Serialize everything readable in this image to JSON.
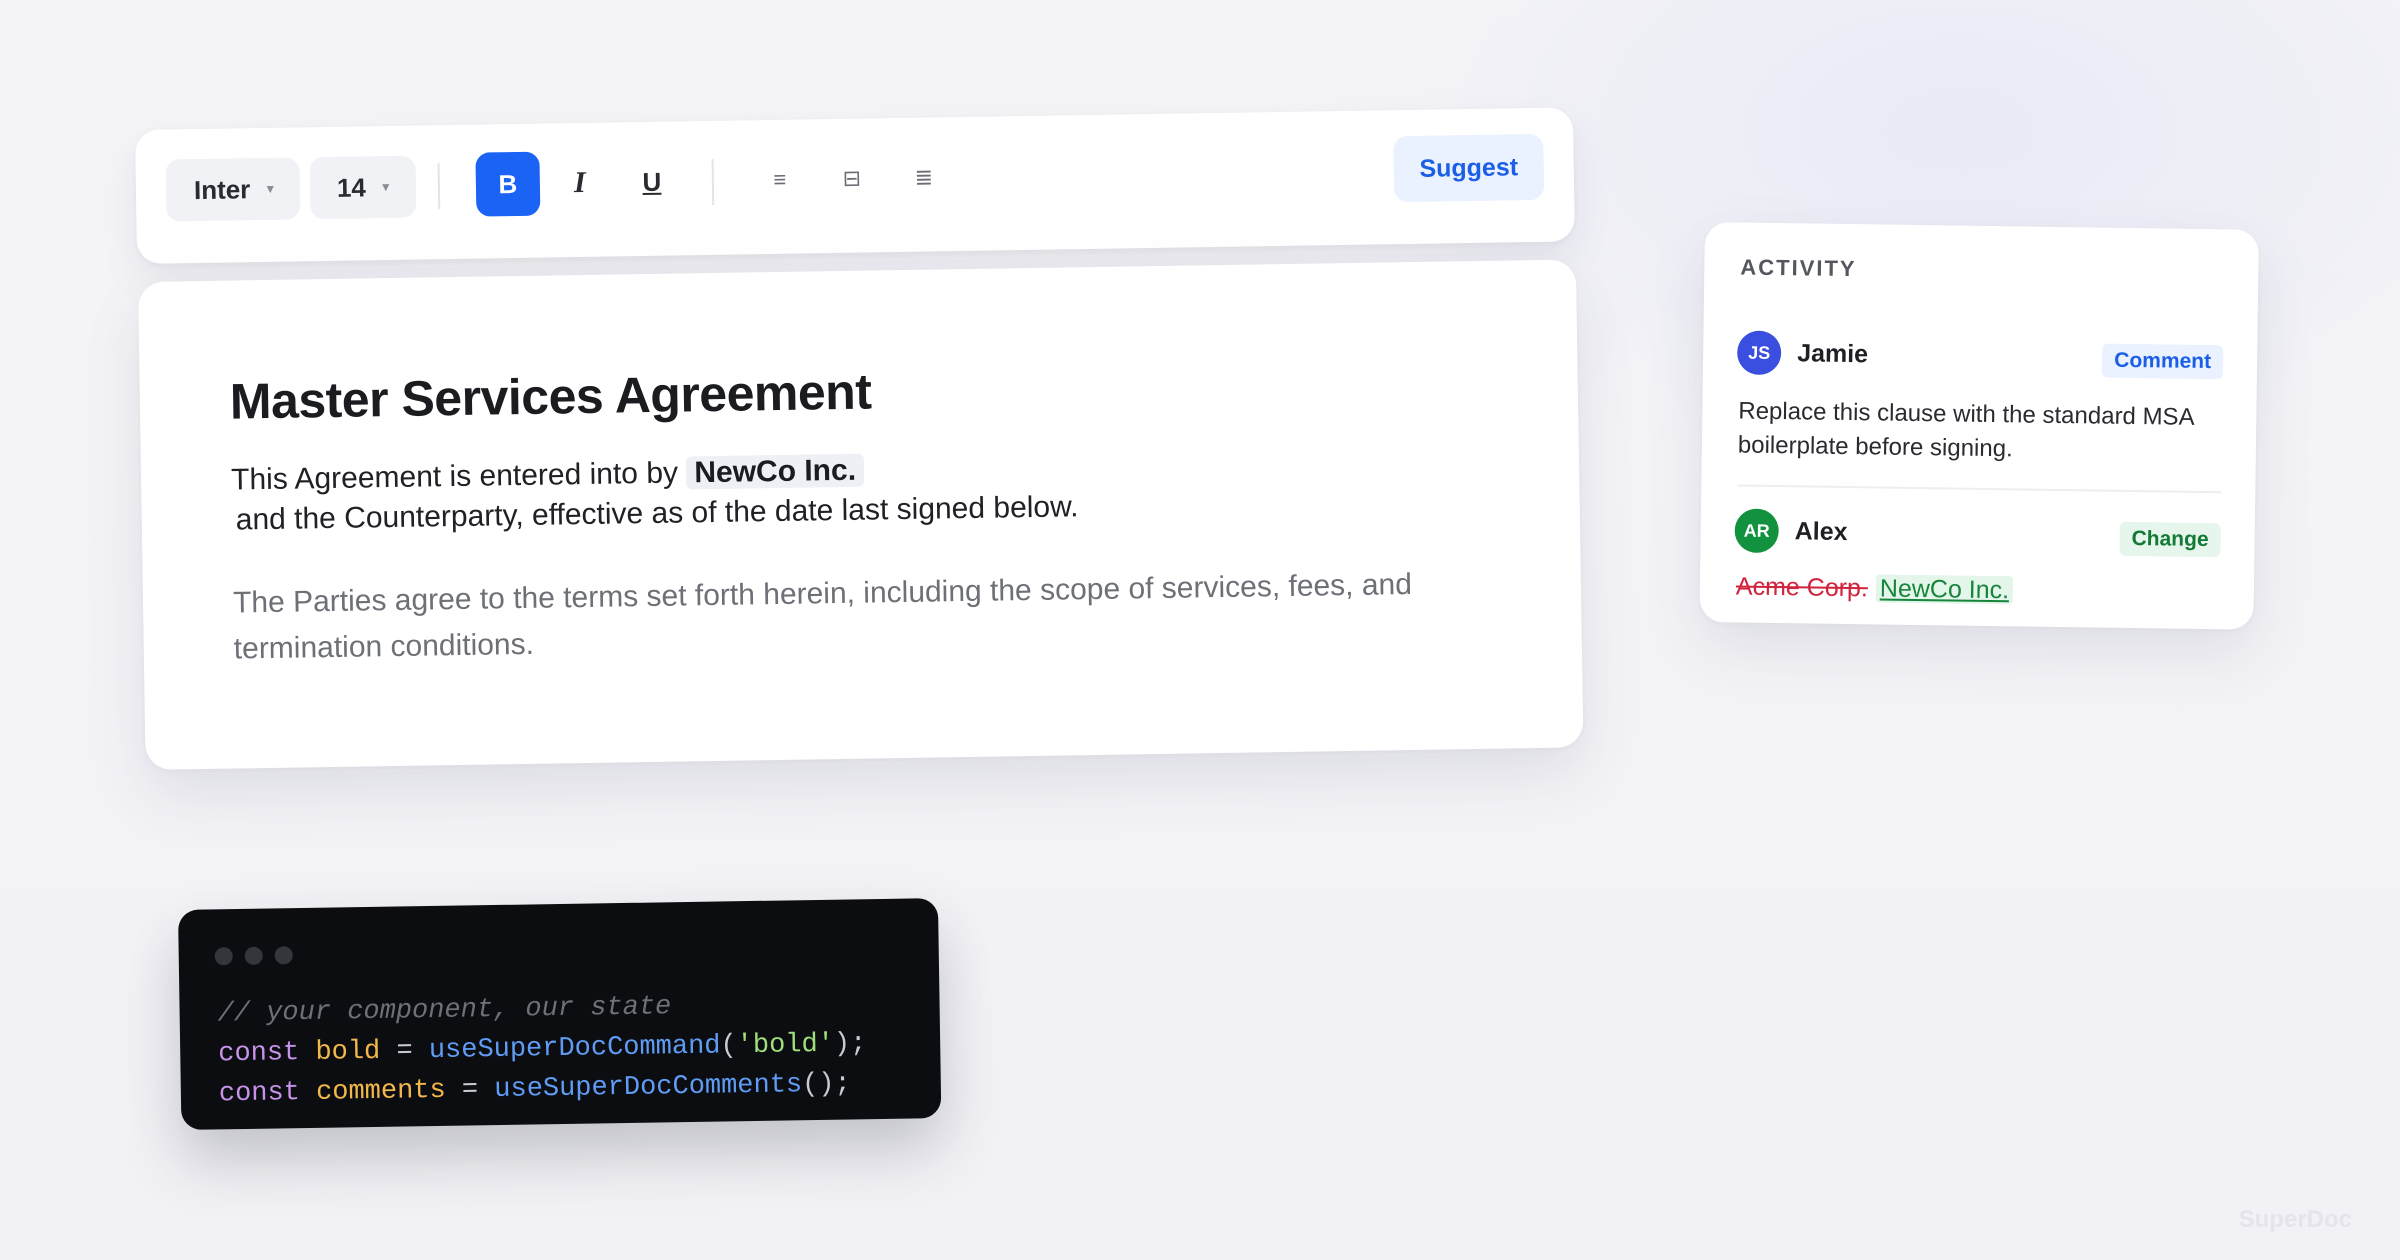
{
  "toolbar": {
    "font": "Inter",
    "size": "14",
    "bold": "B",
    "italic": "I",
    "underline": "U",
    "align_left": "≡",
    "align_center": "⊟",
    "align_justify": "≣",
    "suggest": "Suggest"
  },
  "document": {
    "title": "Master Services Agreement",
    "p1_before": "This Agreement is entered into by",
    "p1_highlight": "NewCo Inc.",
    "p1_line2": "and the Counterparty, effective as of the date last signed below.",
    "p2": "The Parties agree to the terms set forth herein, including the scope of services, fees, and termination conditions."
  },
  "activity": {
    "heading": "ACTIVITY",
    "items": [
      {
        "initials": "JS",
        "name": "Jamie",
        "type": "Comment",
        "text": "Replace this clause with the standard MSA boilerplate before signing."
      },
      {
        "initials": "AR",
        "name": "Alex",
        "type": "Change",
        "deleted": "Acme Corp.",
        "inserted": "NewCo Inc."
      }
    ]
  },
  "code": {
    "comment": "// your component, our state",
    "line2": {
      "kw": "const",
      "var": "bold",
      "op": "=",
      "fn": "useSuperDocCommand",
      "open": "(",
      "str": "'bold'",
      "close": ");"
    },
    "line3": {
      "kw": "const",
      "var": "comments",
      "op": "=",
      "fn": "useSuperDocComments",
      "close": "();"
    }
  },
  "watermark": "SuperDoc",
  "colors": {
    "accent": "#1b63f5",
    "comment_badge": "#1b5fe6",
    "change_badge": "#127a36",
    "deletion": "#d2233d",
    "insertion": "#17853c"
  }
}
